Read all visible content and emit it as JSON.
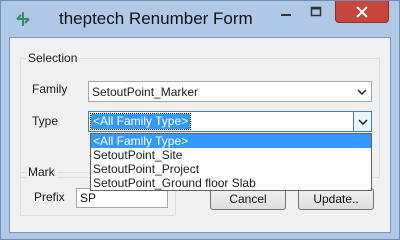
{
  "window": {
    "title": "theptech Renumber Form"
  },
  "selection": {
    "group_label": "Selection",
    "family_label": "Family",
    "family_value": "SetoutPoint_Marker",
    "type_label": "Type",
    "type_value": "<All Family Type>",
    "type_options": [
      "<All Family Type>",
      "SetoutPoint_Site",
      "SetoutPoint_Project",
      "SetoutPoint_Ground floor Slab"
    ]
  },
  "mark": {
    "group_label": "Mark",
    "prefix_label": "Prefix",
    "prefix_value": "SP"
  },
  "buttons": {
    "cancel_label": "Cancel",
    "update_label": "Update.."
  },
  "colors": {
    "title_bar": "#aec8e6",
    "close_button": "#c7453a",
    "selection_highlight": "#3399ff"
  },
  "icons": {
    "app": "revit-like-icon",
    "minimize": "minimize-icon",
    "maximize": "maximize-icon",
    "close": "close-icon",
    "dropdown": "chevron-down-icon"
  }
}
